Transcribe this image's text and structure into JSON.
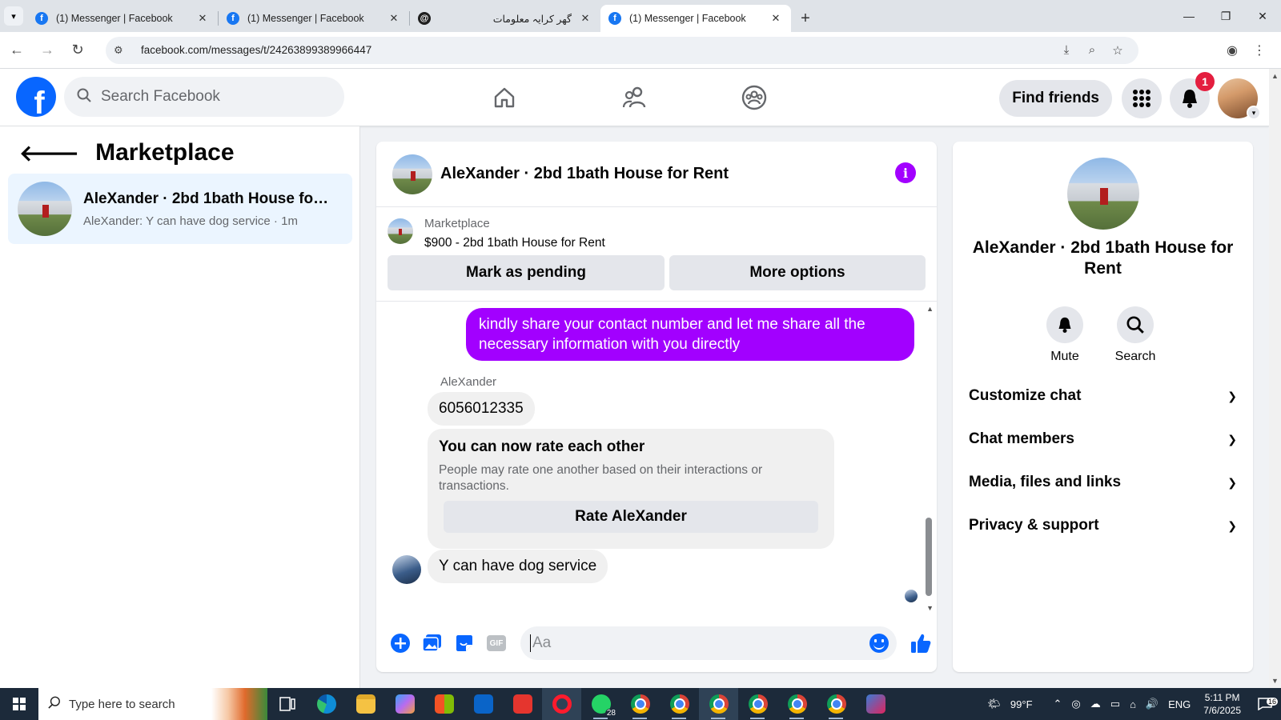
{
  "browser": {
    "tabs": [
      {
        "title": "(1) Messenger | Facebook",
        "favicon": "facebook-icon",
        "active": false
      },
      {
        "title": "(1) Messenger | Facebook",
        "favicon": "facebook-icon",
        "active": false
      },
      {
        "title": "گھر کرایہ معلومات",
        "favicon": "threads-icon",
        "active": false
      },
      {
        "title": "(1) Messenger | Facebook",
        "favicon": "facebook-icon",
        "active": true
      }
    ],
    "url": "facebook.com/messages/t/24263899389966447"
  },
  "fb_header": {
    "logo": "f",
    "search_placeholder": "Search Facebook",
    "find_friends_label": "Find friends",
    "notification_count": "1"
  },
  "left_panel": {
    "title": "Marketplace",
    "conversation": {
      "title": "AleXander · 2bd 1bath House for R...",
      "preview": "AleXander: Y can have dog service · 1m"
    }
  },
  "chat": {
    "header_title": "AleXander · 2bd 1bath House for Rent",
    "info_glyph": "i",
    "listing": {
      "label": "Marketplace",
      "title": "$900 - 2bd 1bath House for Rent",
      "mark_pending_label": "Mark as pending",
      "more_options_label": "More options"
    },
    "messages": {
      "outgoing_1": "kindly share your contact number and let me share all the necessary information with you directly",
      "sender_name": "AleXander",
      "incoming_1": "6056012335",
      "rating_card": {
        "title": "You can now rate each other",
        "description": "People may rate one another based on their interactions or transactions.",
        "button_label": "Rate AleXander"
      },
      "incoming_2": "Y can have dog service"
    },
    "composer": {
      "placeholder": "Aa",
      "gif_label": "GIF"
    }
  },
  "info_panel": {
    "name": "AleXander · 2bd 1bath House for Rent",
    "actions": [
      {
        "label": "Mute",
        "icon": "bell-icon"
      },
      {
        "label": "Search",
        "icon": "search-icon"
      }
    ],
    "sections": [
      {
        "label": "Customize chat"
      },
      {
        "label": "Chat members"
      },
      {
        "label": "Media, files and links"
      },
      {
        "label": "Privacy & support"
      }
    ]
  },
  "taskbar": {
    "search_placeholder": "Type here to search",
    "whatsapp_count": "28",
    "weather": "99°F",
    "language": "ENG",
    "time": "5:11 PM",
    "date": "7/6/2025",
    "notification_count": "16"
  },
  "colors": {
    "fb_blue": "#0866ff",
    "messenger_purple": "#a200ff",
    "badge_red": "#e41e3f"
  }
}
